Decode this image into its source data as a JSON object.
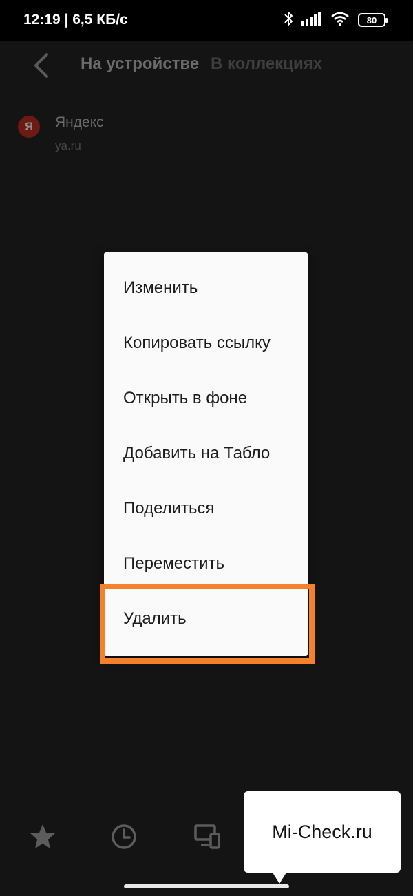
{
  "status_bar": {
    "time": "12:19 | 6,5 КБ/с",
    "battery": "80",
    "icons": [
      "bluetooth-icon",
      "signal-icon",
      "wifi-icon",
      "battery-icon"
    ]
  },
  "header": {
    "back_icon": "chevron-left-icon",
    "tabs": [
      {
        "label": "На устройстве",
        "active": true
      },
      {
        "label": "В коллекциях",
        "active": false
      }
    ]
  },
  "bookmarks": [
    {
      "favicon": "Я",
      "title": "Яндекс",
      "url": "ya.ru"
    }
  ],
  "context_menu": {
    "items": [
      {
        "label": "Изменить"
      },
      {
        "label": "Копировать ссылку"
      },
      {
        "label": "Открыть в фоне"
      },
      {
        "label": "Добавить на Табло"
      },
      {
        "label": "Поделиться"
      },
      {
        "label": "Переместить"
      },
      {
        "label": "Удалить",
        "highlighted": true
      }
    ],
    "highlight_color": "#f5822a"
  },
  "bottom_nav": {
    "icons": [
      "star-icon",
      "clock-icon",
      "devices-icon"
    ]
  },
  "watermark": {
    "text": "Mi-Check.ru"
  }
}
